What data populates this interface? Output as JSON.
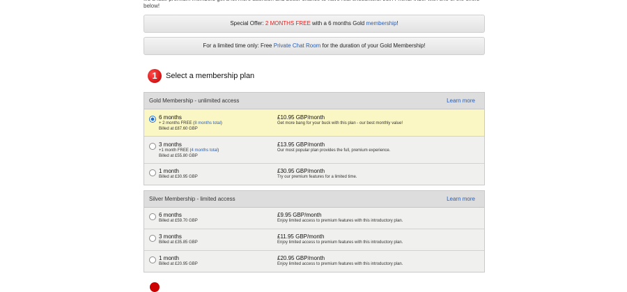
{
  "intro": {
    "text": "It's a fact: premium members get a lot more attention and better chance to have real encounters! Join FriendFinder with one of the offers below!"
  },
  "banners": {
    "offer": {
      "prefix": "Special Offer: ",
      "highlight": "2 MONTHS FREE",
      "middle": " with a 6 months Gold ",
      "link": "membership",
      "suffix": "!"
    },
    "chat": {
      "prefix": "For a limited time only: Free ",
      "link": "Private Chat Room",
      "suffix": " for the duration of your Gold Membership!"
    }
  },
  "step1": {
    "number": "1",
    "title": "Select a membership plan"
  },
  "gold": {
    "title": "Gold Membership - unlimited access",
    "learn_more": "Learn more",
    "plans": [
      {
        "duration": "6 months",
        "bonus_prefix": "+ 2 months FREE (",
        "bonus_link": "8 months total",
        "bonus_suffix": ")",
        "billed": "Billed at £87.60 GBP",
        "price": "£10.95 GBP/month",
        "desc": "Get more bang for your buck with this plan - our best monthly value!",
        "selected": true
      },
      {
        "duration": "3 months",
        "bonus_prefix": "+1 month FREE (",
        "bonus_link": "4 months total",
        "bonus_suffix": ")",
        "billed": "Billed at £55.80 GBP",
        "price": "£13.95 GBP/month",
        "desc": "Our most popular plan provides the full, premium experience.",
        "selected": false
      },
      {
        "duration": "1 month",
        "billed": "Billed at £30.95 GBP",
        "price": "£30.95 GBP/month",
        "desc": "Try our premium features for a limited time.",
        "selected": false
      }
    ]
  },
  "silver": {
    "title": "Silver Membership - limited access",
    "learn_more": "Learn more",
    "plans": [
      {
        "duration": "6 months",
        "billed": "Billed at £59.70 GBP",
        "price": "£9.95 GBP/month",
        "desc": "Enjoy limited access to premium features with this introductory plan.",
        "selected": false
      },
      {
        "duration": "3 months",
        "billed": "Billed at £35.85 GBP",
        "price": "£11.95 GBP/month",
        "desc": "Enjoy limited access to premium features with this introductory plan.",
        "selected": false
      },
      {
        "duration": "1 month",
        "billed": "Billed at £20.95 GBP",
        "price": "£20.95 GBP/month",
        "desc": "Enjoy limited access to premium features with this introductory plan.",
        "selected": false
      }
    ]
  }
}
